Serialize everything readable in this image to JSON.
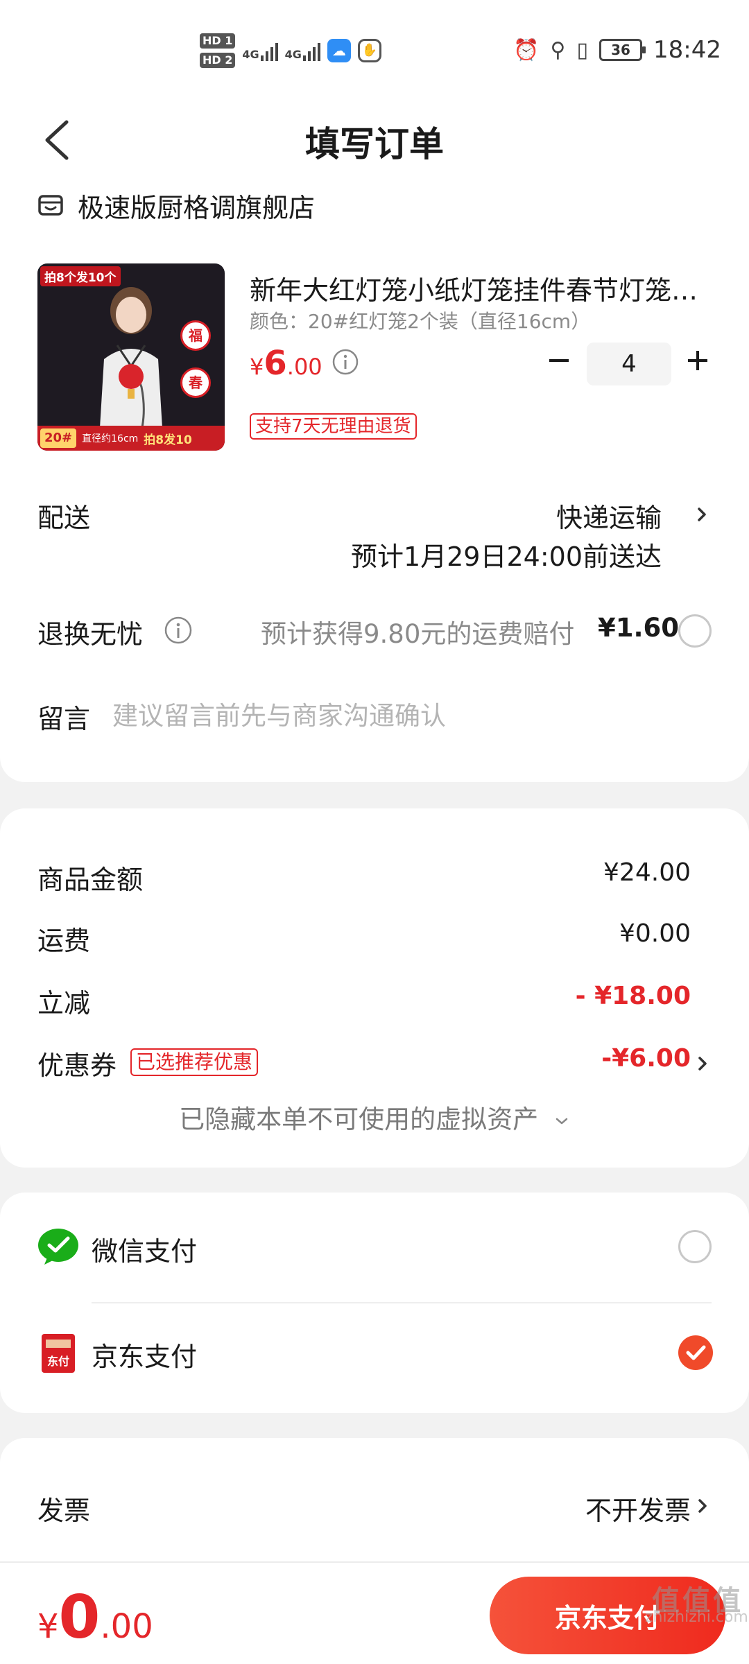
{
  "status_bar": {
    "hd1": "HD 1",
    "hd2": "HD 2",
    "net1": "4G",
    "net2": "4G",
    "battery": "36",
    "time": "18:42"
  },
  "header": {
    "title": "填写订单"
  },
  "store": {
    "name": "极速版厨格调旗舰店"
  },
  "product": {
    "image_tag": "拍8个发10个",
    "image_number": "20#",
    "image_diameter": "直径约16cm",
    "image_promo": "拍8发10",
    "image_badge_1": "福",
    "image_badge_2": "春",
    "title": "新年大红灯笼小纸灯笼挂件春节灯笼装饰",
    "spec": "颜色：20#红灯笼2个装（直径16cm）",
    "price_currency": "¥",
    "price_int": "6",
    "price_dec": ".00",
    "quantity": "4",
    "return_tag": "支持7天无理由退货"
  },
  "delivery": {
    "label": "配送",
    "method": "快递运输",
    "eta": "预计1月29日24:00前送达"
  },
  "return_insurance": {
    "label": "退换无忧",
    "description": "预计获得9.80元的运费赔付",
    "price": "¥1.60"
  },
  "message": {
    "label": "留言",
    "placeholder": "建议留言前先与商家沟通确认"
  },
  "amounts": {
    "goods_label": "商品金额",
    "goods_value": "¥24.00",
    "shipping_label": "运费",
    "shipping_value": "¥0.00",
    "discount_label": "立减",
    "discount_value": "- ¥18.00",
    "coupon_label": "优惠券",
    "coupon_badge": "已选推荐优惠",
    "coupon_value": "-¥6.00",
    "hidden_assets": "已隐藏本单不可使用的虚拟资产"
  },
  "payment": {
    "wechat_label": "微信支付",
    "jd_label": "京东支付",
    "jd_icon_text": "东付",
    "selected": "jd"
  },
  "invoice": {
    "label": "发票",
    "value": "不开发票"
  },
  "footer": {
    "total_currency": "¥",
    "total_int": "0",
    "total_dec": ".00",
    "pay_button": "京东支付"
  },
  "watermark": {
    "logo": "值值值",
    "site": "zhizhizhi.com"
  },
  "colors": {
    "accent_red": "#e4262a",
    "pay_button": "#ef2a1e",
    "wechat_green": "#1aad19",
    "jd_red": "#d81e25"
  }
}
